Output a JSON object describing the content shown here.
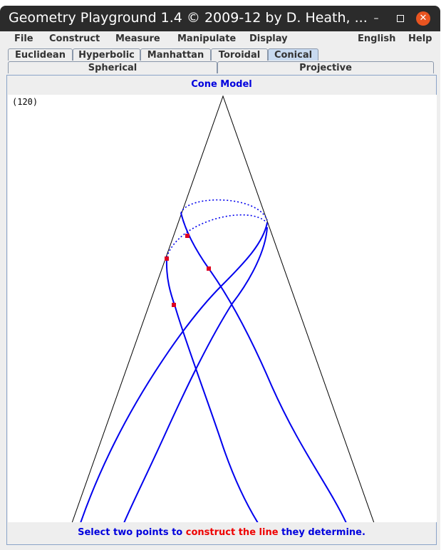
{
  "window": {
    "title": "Geometry Playground 1.4 © 2009-12 by D. Heath, ...",
    "minimize": "–",
    "close": "✕"
  },
  "menubar": {
    "items": [
      "File",
      "Construct",
      "Measure",
      "Manipulate",
      "Display"
    ],
    "right_items": [
      "English",
      "Help"
    ]
  },
  "tabs": {
    "row1": [
      "Euclidean",
      "Hyperbolic",
      "Manhattan",
      "Toroidal",
      "Conical"
    ],
    "row2": [
      "Spherical",
      "Projective"
    ],
    "active": "Conical"
  },
  "panel": {
    "title": "Cone Model",
    "counter": "(120)"
  },
  "status": {
    "part1": "Select two points to ",
    "part2": "construct the line",
    "part3": " they determine."
  },
  "colors": {
    "accent_blue": "#0000dd",
    "highlight_red": "#ee0000",
    "line_color": "#0000ee",
    "point_color": "#dd0022",
    "active_tab": "#c8daf0",
    "close_button": "#e95420"
  },
  "icons": {
    "minimize": "minimize-icon",
    "maximize": "maximize-icon",
    "close": "close-icon"
  }
}
